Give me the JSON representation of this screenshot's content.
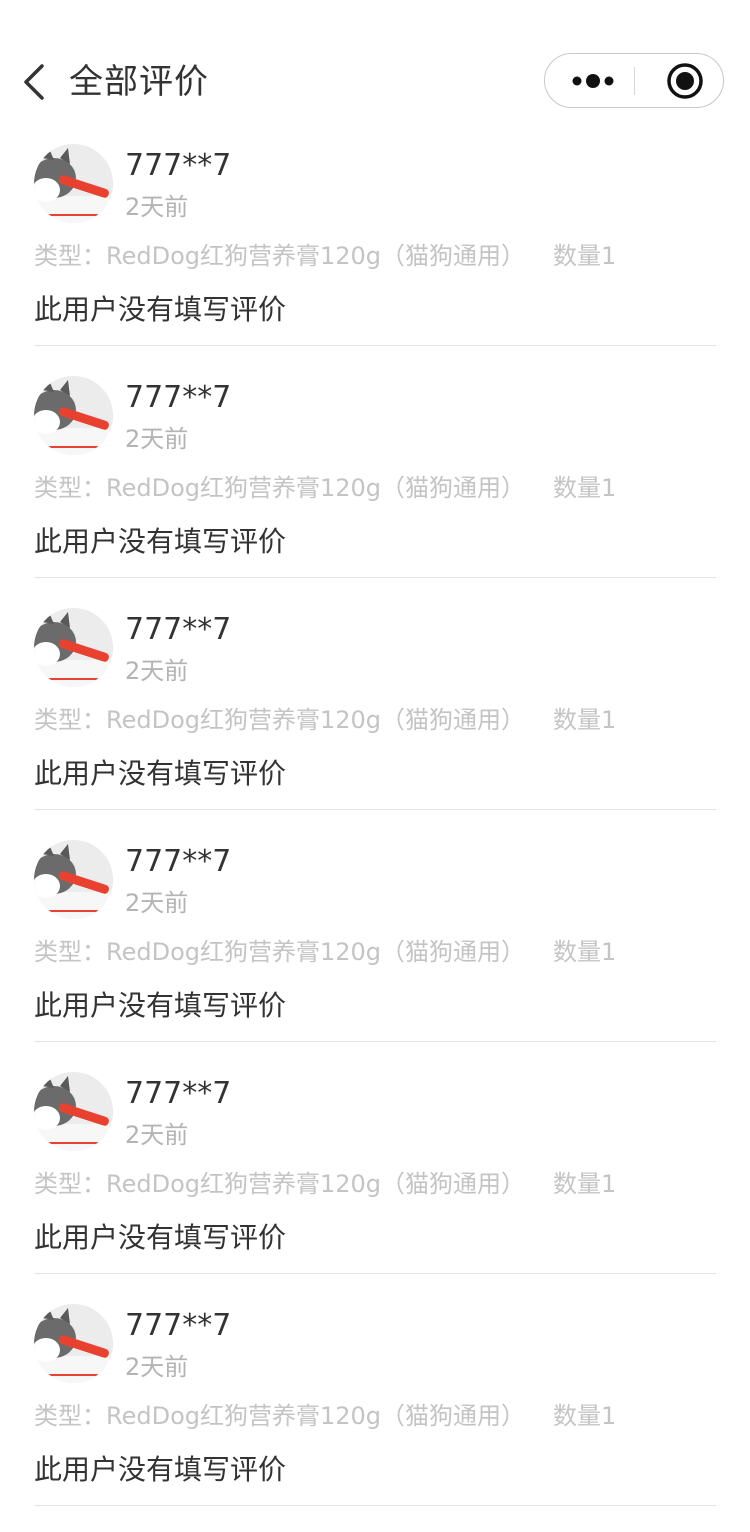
{
  "nav": {
    "title": "全部评价",
    "back_icon": "chevron-left-icon",
    "more_icon": "more-dots-icon",
    "close_icon": "target-circle-icon"
  },
  "colors": {
    "text_primary": "#333333",
    "text_secondary": "#b3b3b3",
    "spec_text": "#c4c4c4",
    "separator": "#e5e5e5",
    "avatar_accent": "#e8412f"
  },
  "reviews": [
    {
      "username": "777**7",
      "time": "2天前",
      "spec": "类型：RedDog红狗营养膏120g（猫狗通用）",
      "quantity": "数量1",
      "content": "此用户没有填写评价"
    },
    {
      "username": "777**7",
      "time": "2天前",
      "spec": "类型：RedDog红狗营养膏120g（猫狗通用）",
      "quantity": "数量1",
      "content": "此用户没有填写评价"
    },
    {
      "username": "777**7",
      "time": "2天前",
      "spec": "类型：RedDog红狗营养膏120g（猫狗通用）",
      "quantity": "数量1",
      "content": "此用户没有填写评价"
    },
    {
      "username": "777**7",
      "time": "2天前",
      "spec": "类型：RedDog红狗营养膏120g（猫狗通用）",
      "quantity": "数量1",
      "content": "此用户没有填写评价"
    },
    {
      "username": "777**7",
      "time": "2天前",
      "spec": "类型：RedDog红狗营养膏120g（猫狗通用）",
      "quantity": "数量1",
      "content": "此用户没有填写评价"
    },
    {
      "username": "777**7",
      "time": "2天前",
      "spec": "类型：RedDog红狗营养膏120g（猫狗通用）",
      "quantity": "数量1",
      "content": "此用户没有填写评价"
    }
  ]
}
